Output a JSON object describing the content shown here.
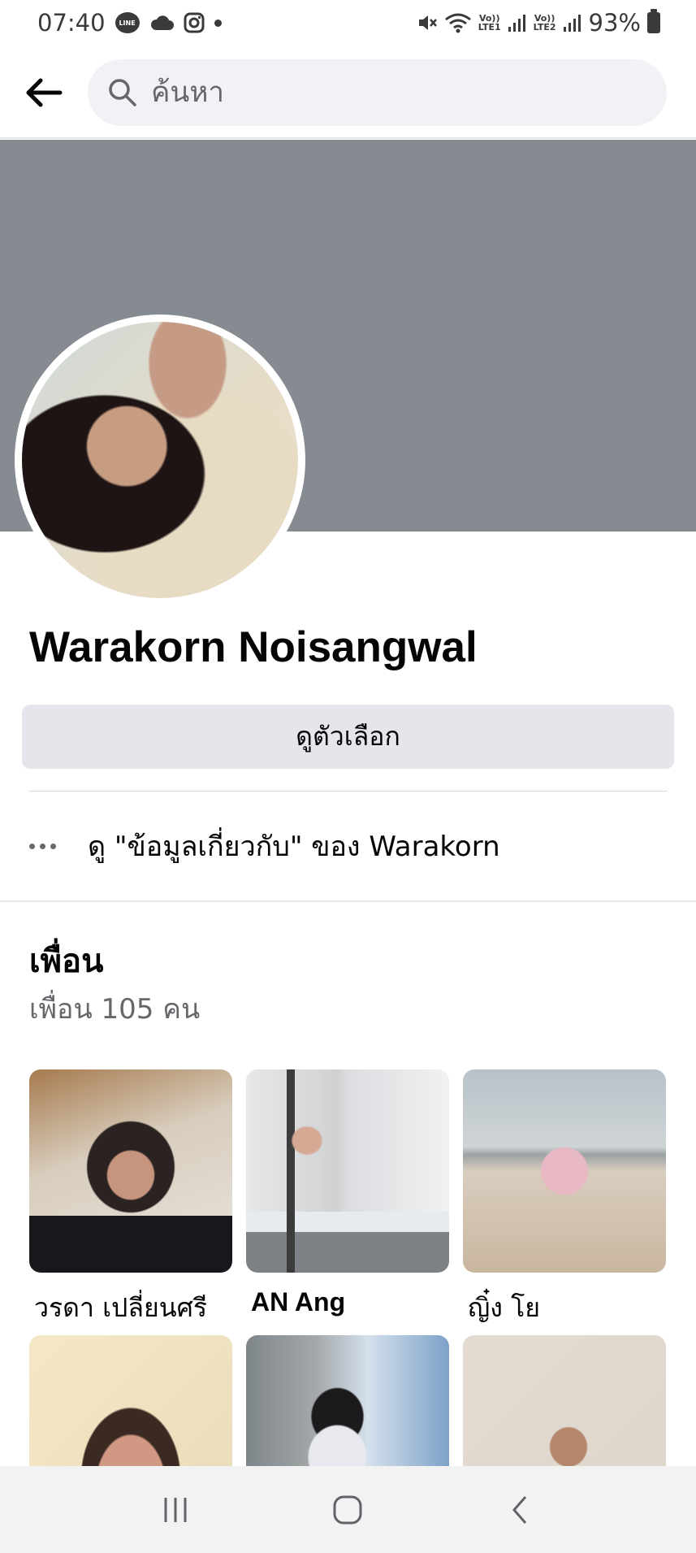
{
  "status_bar": {
    "time": "07:40",
    "line_icon_text": "LINE",
    "lte1_top": "Vo))",
    "lte1_bottom": "LTE1",
    "lte2_top": "Vo))",
    "lte2_bottom": "LTE2",
    "battery_percent": "93%"
  },
  "header": {
    "search_placeholder": "ค้นหา"
  },
  "profile": {
    "name": "Warakorn Noisangwal",
    "options_button_label": "ดูตัวเลือก",
    "about_link_text": "ดู \"ข้อมูลเกี่ยวกับ\" ของ Warakorn"
  },
  "friends": {
    "title": "เพื่อน",
    "count_text": "เพื่อน 105 คน",
    "items": [
      {
        "name": "วรดา เปลี่ยนศรี"
      },
      {
        "name": "AN Ang"
      },
      {
        "name": "ญิ๋ง โย"
      },
      {
        "name": ""
      },
      {
        "name": ""
      },
      {
        "name": ""
      }
    ]
  },
  "icons": {
    "back": "arrow-left-icon",
    "search": "search-icon",
    "more": "more-horizontal-icon",
    "nav_recents": "recents-icon",
    "nav_home": "home-icon",
    "nav_back": "back-icon"
  }
}
